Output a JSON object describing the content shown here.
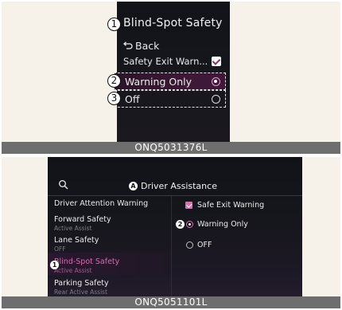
{
  "top_panel": {
    "title": "Blind-Spot Safety",
    "back_label": "Back",
    "safety_exit_label": "Safety Exit Warn...",
    "options": [
      {
        "label": "Warning Only",
        "selected": true
      },
      {
        "label": "Off",
        "selected": false
      }
    ],
    "callouts": [
      "1",
      "2",
      "3"
    ],
    "caption": "ONQ5031376L"
  },
  "bottom_panel": {
    "header_title": "Driver Assistance",
    "header_callout": "A",
    "left_menu": [
      {
        "label": "Driver Attention Warning",
        "sub": ""
      },
      {
        "label": "Forward Safety",
        "sub": "Active Assist"
      },
      {
        "label": "Lane Safety",
        "sub": "OFF"
      },
      {
        "label": "Blind-Spot Safety",
        "sub": "Active Assist",
        "selected": true
      },
      {
        "label": "Parking Safety",
        "sub": "Rear Active Assist"
      }
    ],
    "left_callout": "1",
    "right_items": [
      {
        "label": "Safe Exit Warning",
        "type": "checkbox",
        "checked": true
      },
      {
        "label": "Warning Only",
        "type": "radio",
        "selected": true
      },
      {
        "label": "OFF",
        "type": "radio",
        "selected": false
      }
    ],
    "right_callout": "2",
    "caption": "ONQ5051101L"
  },
  "icons": {
    "search": "search-icon",
    "back": "back-arrow-icon",
    "check": "checkmark-icon",
    "radio": "radio-icon"
  },
  "colors": {
    "accent": "#d86fb2",
    "screen_bg": "#15161b",
    "caption_bg": "#6e6e6e",
    "page_bg": "#f7f2e9"
  }
}
